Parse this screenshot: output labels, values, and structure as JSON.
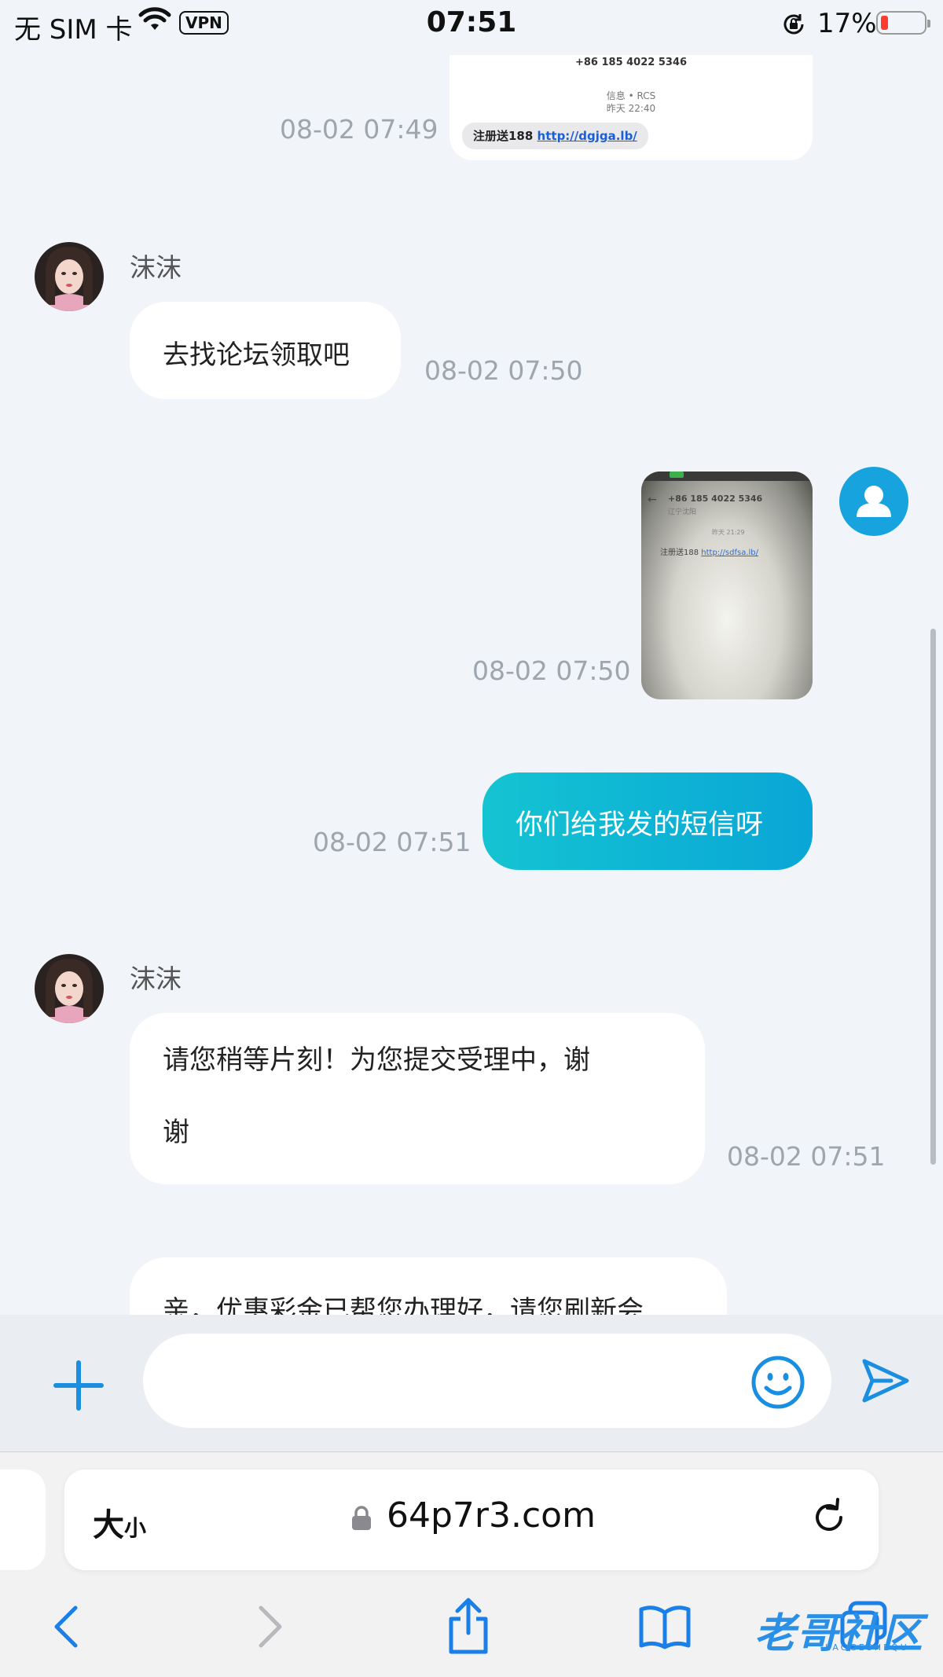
{
  "status_bar": {
    "carrier": "无 SIM 卡",
    "vpn": "VPN",
    "time": "07:51",
    "battery_percent": "17%",
    "battery_level": 0.17,
    "battery_color": "#ff3b30"
  },
  "messages": [
    {
      "from": "me",
      "type": "sms_screenshot",
      "time": "08-02 07:49",
      "sms": {
        "number": "+86 185 4022 5346",
        "service": "信息 • RCS",
        "received": "昨天 22:40",
        "text": "注册送188",
        "link": "http://dgjga.lb/"
      }
    },
    {
      "from": "agent",
      "sender": "沫沫",
      "type": "text",
      "text": "去找论坛领取吧",
      "time": "08-02 07:50"
    },
    {
      "from": "me",
      "type": "photo",
      "time": "08-02 07:50",
      "photo": {
        "number": "+86 185 4022 5346",
        "region": "辽宁沈阳",
        "received": "昨天 21:29",
        "text": "注册送188",
        "link": "http://sdfsa.lb/"
      }
    },
    {
      "from": "me",
      "type": "text",
      "text": "你们给我发的短信呀",
      "time": "08-02 07:51"
    },
    {
      "from": "agent",
      "sender": "沫沫",
      "type": "text",
      "text_line1": "请您稍等片刻！为您提交受理中，谢",
      "text_line2": "谢",
      "time": "08-02 07:51"
    },
    {
      "from": "agent",
      "type": "text",
      "text": "亲，优惠彩金已帮您办理好，请您刷新会"
    }
  ],
  "input": {
    "placeholder": "",
    "value": ""
  },
  "safari": {
    "text_size_label": "大",
    "text_size_small": "小",
    "domain": "64p7r3.com"
  },
  "watermark": {
    "title": "老哥社区",
    "subtitle": "LAOGESHEQU"
  },
  "icons": {
    "add": "plus-icon",
    "emoji": "smiley-icon",
    "send": "send-icon",
    "back": "chevron-left-icon",
    "forward": "chevron-right-icon",
    "share": "share-icon",
    "bookmarks": "book-icon",
    "tabs": "tabs-icon",
    "reload": "reload-icon",
    "lock": "lock-icon"
  },
  "colors": {
    "accent": "#1a8fe2",
    "my_bubble_start": "#14c4d2",
    "my_bubble_end": "#0aa6d6",
    "my_avatar": "#17a3dd"
  }
}
